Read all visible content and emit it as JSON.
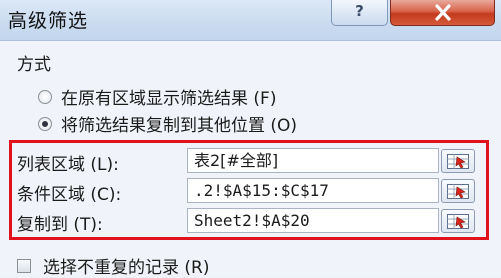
{
  "dialog": {
    "title": "高级筛选",
    "help_label": "?"
  },
  "method": {
    "section_label": "方式",
    "options": [
      {
        "label": "在原有区域显示筛选结果 (F)",
        "checked": false
      },
      {
        "label": "将筛选结果复制到其他位置 (O)",
        "checked": true
      }
    ]
  },
  "fields": {
    "list_range": {
      "label": "列表区域 (L):",
      "value": "表2[#全部]"
    },
    "criteria_range": {
      "label": "条件区域 (C):",
      "value": ".2!$A$15:$C$17"
    },
    "copy_to": {
      "label": "复制到 (T):",
      "value": "Sheet2!$A$20"
    }
  },
  "unique": {
    "label": "选择不重复的记录 (R)",
    "checked": false
  },
  "colors": {
    "highlight_border": "#e0121b",
    "close_button": "#c43b1e"
  }
}
